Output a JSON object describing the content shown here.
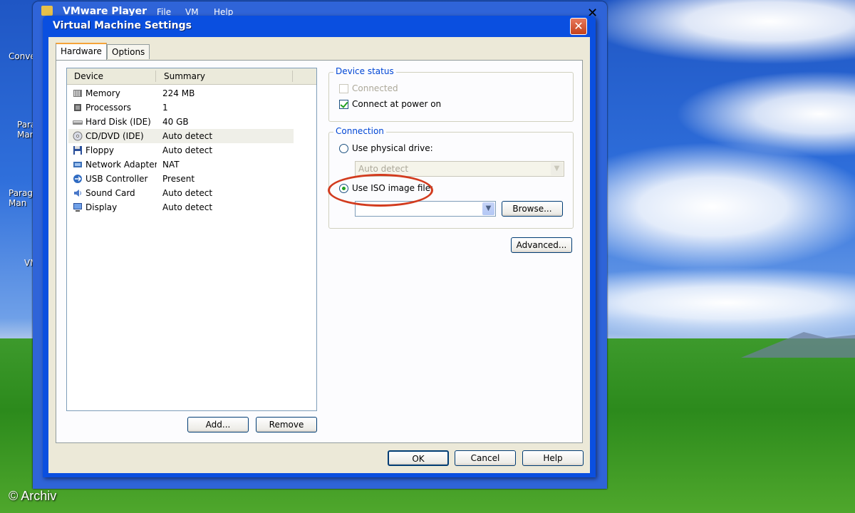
{
  "desktop": {
    "icons": [
      "Conve",
      "Para\nMan",
      "Parag\nMan",
      "VM"
    ],
    "copyright": "© Archiv"
  },
  "player": {
    "title": "VMware Player",
    "menu": [
      "File",
      "VM",
      "Help"
    ],
    "logo": "vmware"
  },
  "dialog": {
    "title": "Virtual Machine Settings",
    "tabs": [
      "Hardware",
      "Options"
    ],
    "list": {
      "headers": [
        "Device",
        "Summary"
      ],
      "rows": [
        {
          "name": "Memory",
          "summary": "224 MB",
          "icon": "memory-icon"
        },
        {
          "name": "Processors",
          "summary": "1",
          "icon": "processor-icon"
        },
        {
          "name": "Hard Disk (IDE)",
          "summary": "40 GB",
          "icon": "hard-disk-icon"
        },
        {
          "name": "CD/DVD (IDE)",
          "summary": "Auto detect",
          "icon": "cd-dvd-icon"
        },
        {
          "name": "Floppy",
          "summary": "Auto detect",
          "icon": "floppy-icon"
        },
        {
          "name": "Network Adapter",
          "summary": "NAT",
          "icon": "network-adapter-icon"
        },
        {
          "name": "USB Controller",
          "summary": "Present",
          "icon": "usb-icon"
        },
        {
          "name": "Sound Card",
          "summary": "Auto detect",
          "icon": "sound-card-icon"
        },
        {
          "name": "Display",
          "summary": "Auto detect",
          "icon": "display-icon"
        }
      ],
      "selected": 3
    },
    "add_label": "Add...",
    "remove_label": "Remove",
    "device_status": {
      "label": "Device status",
      "connected": "Connected",
      "connect_at_power_on": "Connect at power on"
    },
    "connection": {
      "label": "Connection",
      "physical": "Use physical drive:",
      "physical_value": "Auto detect",
      "iso": "Use ISO image file:",
      "iso_value": "",
      "browse": "Browse..."
    },
    "advanced_label": "Advanced...",
    "ok_label": "OK",
    "cancel_label": "Cancel",
    "help_label": "Help"
  },
  "colors": {
    "highlight_ring": "#d23b1e",
    "titlebar": "#0a4fe0",
    "group_label": "#0046d5"
  }
}
